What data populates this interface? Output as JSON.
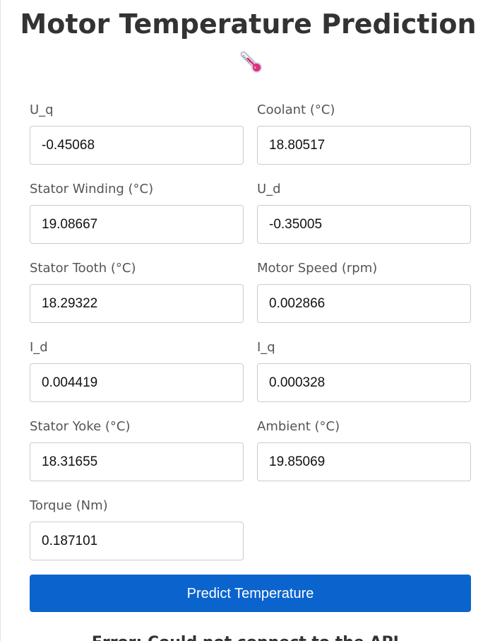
{
  "header": {
    "title": "Motor Temperature Prediction",
    "icon": "thermometer-icon"
  },
  "form": {
    "fields": [
      {
        "label": "U_q",
        "value": "-0.45068"
      },
      {
        "label": "Coolant (°C)",
        "value": "18.80517"
      },
      {
        "label": "Stator Winding (°C)",
        "value": "19.08667"
      },
      {
        "label": "U_d",
        "value": "-0.35005"
      },
      {
        "label": "Stator Tooth (°C)",
        "value": "18.29322"
      },
      {
        "label": "Motor Speed (rpm)",
        "value": "0.002866"
      },
      {
        "label": "I_d",
        "value": "0.004419"
      },
      {
        "label": "I_q",
        "value": "0.000328"
      },
      {
        "label": "Stator Yoke (°C)",
        "value": "18.31655"
      },
      {
        "label": "Ambient (°C)",
        "value": "19.85069"
      },
      {
        "label": "Torque (Nm)",
        "value": "0.187101"
      }
    ],
    "submit_label": "Predict Temperature"
  },
  "status": {
    "message": "Error: Could not connect to the API."
  },
  "colors": {
    "button_background": "#0b63ce",
    "button_text": "#ffffff",
    "title_text": "#333333",
    "label_text": "#555555",
    "input_border": "#cccccc"
  }
}
